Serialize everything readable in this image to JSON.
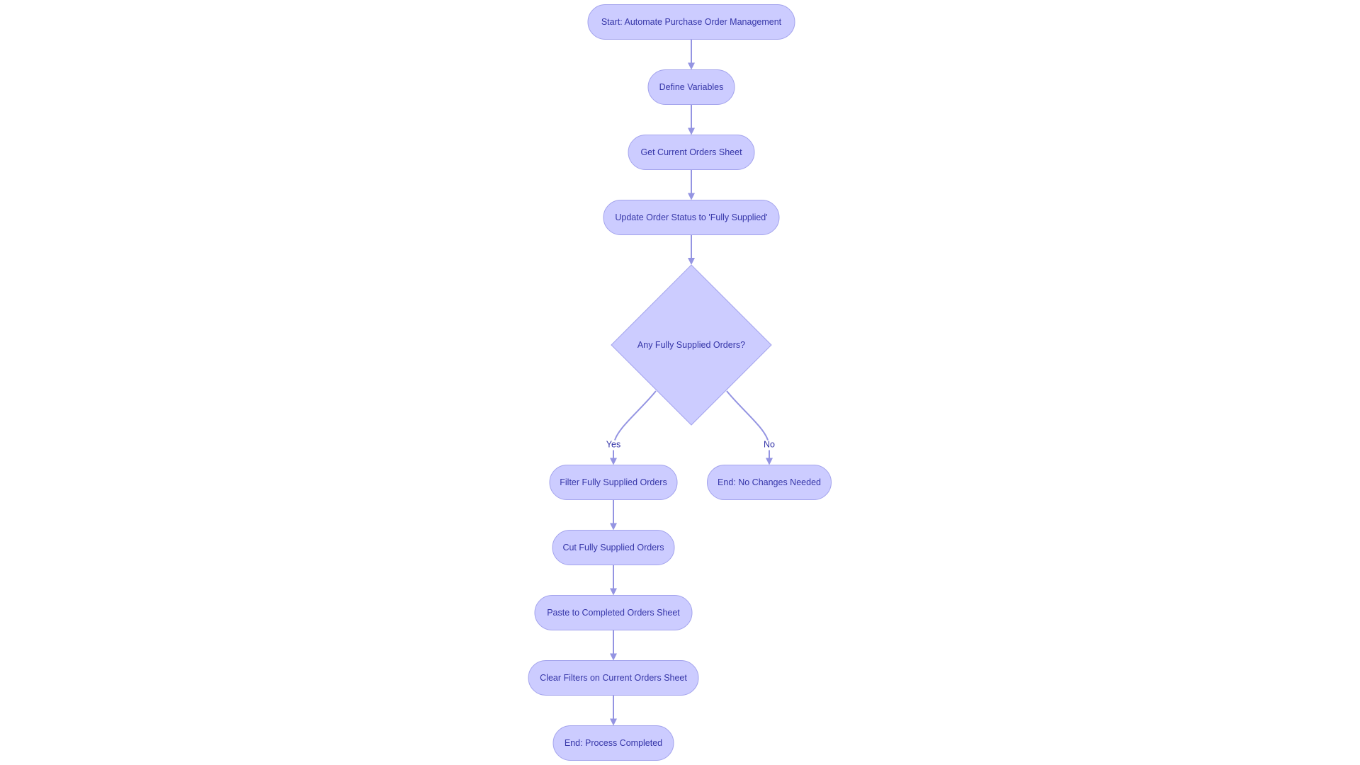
{
  "diagram": {
    "type": "flowchart",
    "direction": "top-down",
    "colors": {
      "node_fill": "#ccccff",
      "node_border": "#a3a3ec",
      "text": "#3535a8",
      "edge": "#9494e2",
      "background": "#ffffff"
    },
    "nodes": [
      {
        "id": "start",
        "label": "Start: Automate Purchase Order Management",
        "shape": "stadium"
      },
      {
        "id": "define",
        "label": "Define Variables",
        "shape": "stadium"
      },
      {
        "id": "get",
        "label": "Get Current Orders Sheet",
        "shape": "stadium"
      },
      {
        "id": "update",
        "label": "Update Order Status to 'Fully Supplied'",
        "shape": "stadium"
      },
      {
        "id": "decision",
        "label": "Any Fully Supplied Orders?",
        "shape": "diamond"
      },
      {
        "id": "filter",
        "label": "Filter Fully Supplied Orders",
        "shape": "stadium"
      },
      {
        "id": "nochange",
        "label": "End: No Changes Needed",
        "shape": "stadium"
      },
      {
        "id": "cut",
        "label": "Cut Fully Supplied Orders",
        "shape": "stadium"
      },
      {
        "id": "paste",
        "label": "Paste to Completed Orders Sheet",
        "shape": "stadium"
      },
      {
        "id": "clear",
        "label": "Clear Filters on Current Orders Sheet",
        "shape": "stadium"
      },
      {
        "id": "end",
        "label": "End: Process Completed",
        "shape": "stadium"
      }
    ],
    "edges": [
      {
        "from": "start",
        "to": "define",
        "label": ""
      },
      {
        "from": "define",
        "to": "get",
        "label": ""
      },
      {
        "from": "get",
        "to": "update",
        "label": ""
      },
      {
        "from": "update",
        "to": "decision",
        "label": ""
      },
      {
        "from": "decision",
        "to": "filter",
        "label": "Yes"
      },
      {
        "from": "decision",
        "to": "nochange",
        "label": "No"
      },
      {
        "from": "filter",
        "to": "cut",
        "label": ""
      },
      {
        "from": "cut",
        "to": "paste",
        "label": ""
      },
      {
        "from": "paste",
        "to": "clear",
        "label": ""
      },
      {
        "from": "clear",
        "to": "end",
        "label": ""
      }
    ]
  }
}
